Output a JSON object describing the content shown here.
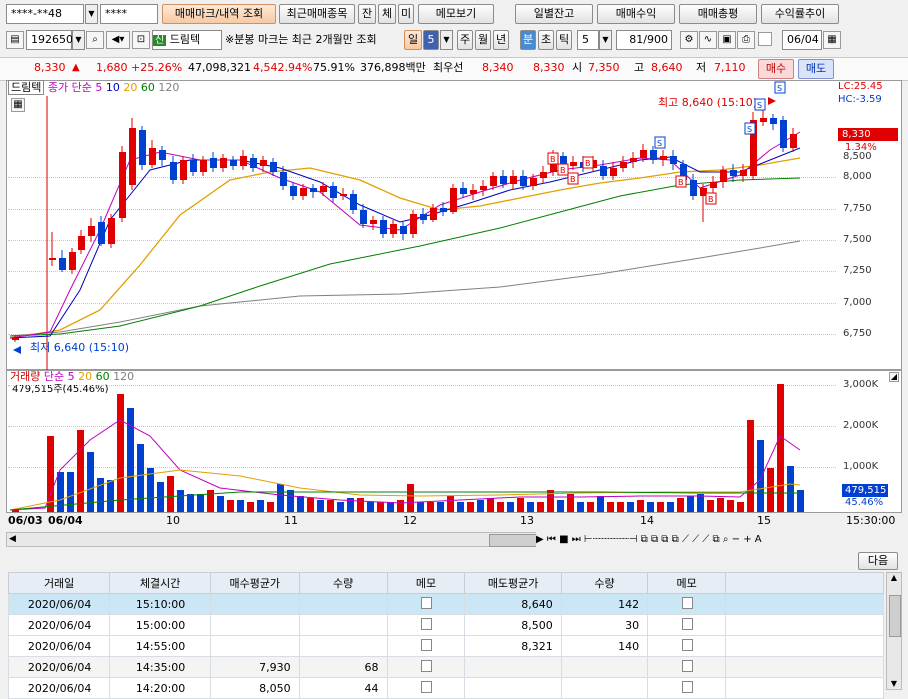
{
  "toolbar1": {
    "account": "****-**48",
    "password": "****",
    "btn_memo_marks": "매매마크/내역 조회",
    "btn_recent_items": "최근매매종목",
    "btn_jan": "잔",
    "btn_che": "체",
    "btn_mi": "미",
    "btn_memo_view": "메모보기",
    "btn_daily_balance": "일별잔고",
    "btn_trade_profit": "매매수익",
    "btn_trade_summary": "매매총평",
    "btn_return_trend": "수익률추이"
  },
  "toolbar2": {
    "code": "192650",
    "stock_name": "드림텍",
    "badge": "신",
    "notice": "※분봉 마크는 최근 2개월만 조회",
    "period_day": "일",
    "period_value": "5",
    "tabs": [
      "주",
      "월",
      "년",
      "분",
      "초",
      "틱"
    ],
    "interval": "5",
    "count": "81/900",
    "date": "06/04"
  },
  "quote": {
    "price": "8,330",
    "arrow": "▲",
    "change": "1,680",
    "change_pct": "+25.26%",
    "volume": "47,098,321",
    "volume_pct": "4,542.94%",
    "ratio": "75.91%",
    "amount": "376,898백만",
    "best_label": "최우선",
    "ask": "8,340",
    "bid": "8,330",
    "open_label": "시",
    "open": "7,350",
    "high_label": "고",
    "high": "8,640",
    "low_label": "저",
    "low": "7,110",
    "buy_btn": "매수",
    "sell_btn": "매도"
  },
  "price_chart": {
    "stock_tag": "드림텍",
    "ma_label": "종가 단순",
    "ma_periods": [
      "5",
      "10",
      "20",
      "60",
      "120"
    ],
    "ma_colors": [
      "#c000c0",
      "#0000c0",
      "#e0a000",
      "#008000",
      "#808080"
    ],
    "high_marker": "최고 8,640 (15:10)",
    "low_marker": "최저 6,640 (15:10)",
    "lc": "LC:25.45",
    "hc": "HC:-3.59",
    "current_price_tag": "8,330",
    "current_pct_tag": "1.34%",
    "y_ticks": [
      "8,500",
      "8,250",
      "8,000",
      "7,750",
      "7,500",
      "7,250",
      "7,000",
      "6,750"
    ]
  },
  "volume_chart": {
    "label": "거래량",
    "ma_label": "단순",
    "ma_periods": [
      "5",
      "20",
      "60",
      "120"
    ],
    "info": "479,515주(45.46%)",
    "y_ticks": [
      "3,000K",
      "2,000K",
      "1,000K"
    ],
    "current_tag": "479,515",
    "current_pct": "45.46%"
  },
  "x_axis": {
    "labels": [
      "06/03",
      "06/04",
      "10",
      "11",
      "12",
      "13",
      "14",
      "15"
    ],
    "end_time": "15:30:00"
  },
  "next_button": "다음",
  "trade_table": {
    "headers": [
      "거래일",
      "체결시간",
      "매수평균가",
      "수량",
      "메모",
      "매도평균가",
      "수량",
      "메모"
    ],
    "rows": [
      [
        "2020/06/04",
        "15:10:00",
        "",
        "",
        "",
        "8,640",
        "142",
        ""
      ],
      [
        "2020/06/04",
        "15:00:00",
        "",
        "",
        "",
        "8,500",
        "30",
        ""
      ],
      [
        "2020/06/04",
        "14:55:00",
        "",
        "",
        "",
        "8,321",
        "140",
        ""
      ],
      [
        "2020/06/04",
        "14:35:00",
        "7,930",
        "68",
        "",
        "",
        "",
        ""
      ],
      [
        "2020/06/04",
        "14:20:00",
        "8,050",
        "44",
        "",
        "",
        "",
        ""
      ]
    ]
  },
  "colors": {
    "up": "#e00000",
    "down": "#0040d0",
    "selected_row": "#cbe6f5"
  }
}
